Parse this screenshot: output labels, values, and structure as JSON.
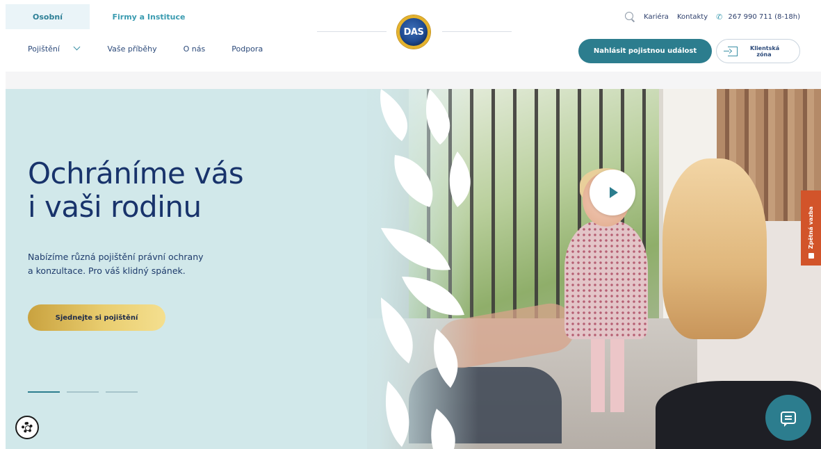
{
  "header": {
    "segments": [
      {
        "label": "Osobní",
        "active": true
      },
      {
        "label": "Firmy a Instituce",
        "active": false
      }
    ],
    "utility": {
      "search_icon": "search-icon",
      "career": "Kariéra",
      "contacts": "Kontakty",
      "phone_icon": "phone-icon",
      "phone": "267 990 711 (8-18h)"
    },
    "logo_text": "DAS",
    "nav": [
      {
        "label": "Pojištění",
        "has_dropdown": true
      },
      {
        "label": "Vaše příběhy"
      },
      {
        "label": "O nás"
      },
      {
        "label": "Podpora"
      }
    ],
    "report_button": "Nahlásit pojistnou událost",
    "client_zone": "Klientská zóna"
  },
  "hero": {
    "title_line1": "Ochráníme vás",
    "title_line2": "i vaši rodinu",
    "subtitle_line1": "Nabízíme různá pojištění právní ochrany",
    "subtitle_line2": "a konzultace. Pro váš klidný spánek.",
    "cta": "Sjednejte si pojištění",
    "slides": 3,
    "active_slide": 1
  },
  "widgets": {
    "callback": "Zpětná vazba",
    "chat_icon": "chat-icon",
    "play_icon": "play-icon",
    "settings_icon": "gear-icon"
  },
  "colors": {
    "primary": "#2c7d8e",
    "navy": "#18336b",
    "hero_bg": "#d1e8ea",
    "gold": "#e9cd6f",
    "callback": "#d2542a"
  }
}
